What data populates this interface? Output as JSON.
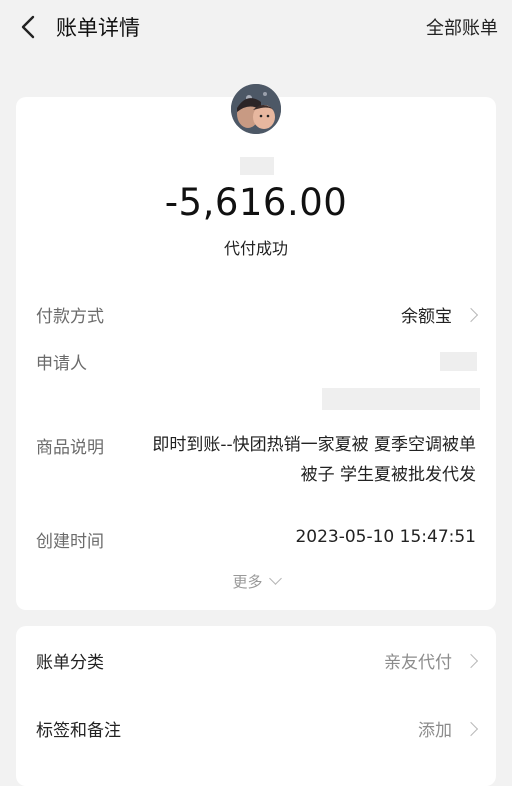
{
  "header": {
    "title": "账单详情",
    "all_bills_label": "全部账单"
  },
  "summary": {
    "amount": "-5,616.00",
    "status": "代付成功"
  },
  "details": {
    "payment_method_label": "付款方式",
    "payment_method_value": "余额宝",
    "applicant_label": "申请人",
    "goods_desc_label": "商品说明",
    "goods_desc_value": "即时到账--快团热销一家夏被 夏季空调被单被子 学生夏被批发代发",
    "created_time_label": "创建时间",
    "created_time_value": "2023-05-10 15:47:51",
    "more_label": "更多"
  },
  "extra": {
    "category_label": "账单分类",
    "category_value": "亲友代付",
    "tags_label": "标签和备注",
    "tags_value": "添加"
  },
  "colors": {
    "background": "#f2f2f2",
    "card": "#ffffff",
    "label": "#6b6b6b",
    "text": "#222222"
  }
}
